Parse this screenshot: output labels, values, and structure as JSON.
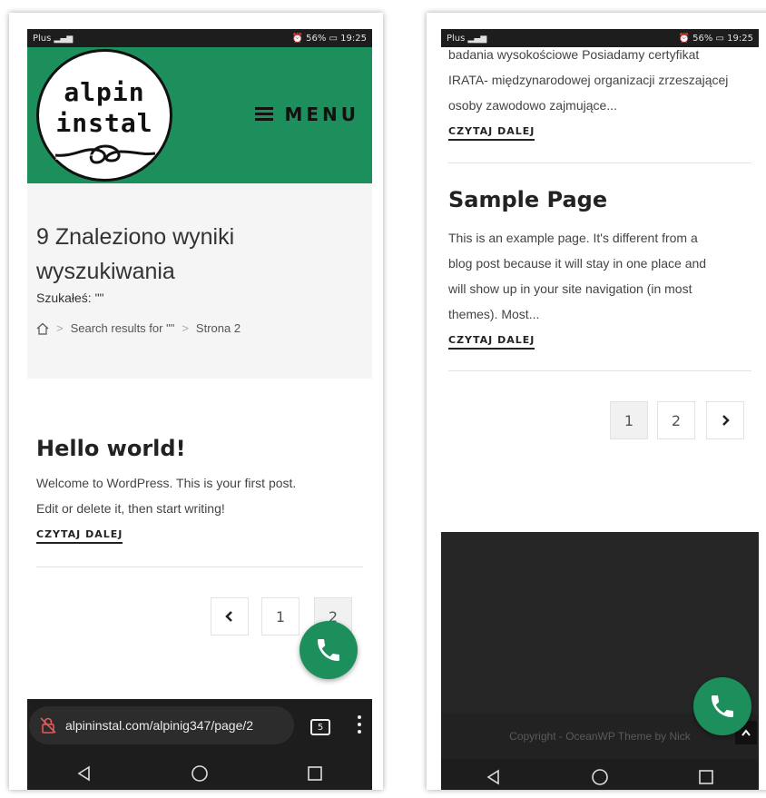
{
  "left": {
    "status": {
      "carrier": "Plus",
      "right": "56%",
      "time": "19:25"
    },
    "logo": {
      "line1": "alpin",
      "line2": "instal"
    },
    "menu_label": "MENU",
    "search": {
      "title": "9 Znaleziono wyniki wyszukiwania",
      "subtitle": "Szukałeś: \"\"",
      "breadcrumb": [
        "Search results for \"\"",
        "Strona 2"
      ]
    },
    "post": {
      "title": "Hello world!",
      "lines": [
        "Welcome to WordPress. This is your first post.",
        "Edit or delete it, then start writing!"
      ],
      "more": "CZYTAJ DALEJ"
    },
    "pagination": [
      "1",
      "2"
    ],
    "url": "alpininstal.com/alpinig347/page/2",
    "tab_count": "5"
  },
  "right": {
    "status": {
      "carrier": "Plus",
      "right": "56%",
      "time": "19:25"
    },
    "prev_text": [
      "badania wysokościowe Posiadamy certyfikat",
      "IRATA- międzynarodowej organizacji zrzeszającej",
      "osoby zawodowo zajmujące..."
    ],
    "prev_more": "CZYTAJ DALEJ",
    "post": {
      "title": "Sample Page",
      "lines": [
        "This is an example page. It's different from a",
        "blog post because it will stay in one place and",
        "will show up in your site navigation (in most",
        "themes). Most..."
      ],
      "more": "CZYTAJ DALEJ"
    },
    "pagination": [
      "1",
      "2"
    ],
    "copyright": "Copyright - OceanWP Theme by Nick"
  },
  "colors": {
    "brand_green": "#1d8f5c",
    "dark": "#1d1d1d"
  },
  "icons": [
    "home-icon",
    "hamburger-icon",
    "chevron-left-icon",
    "chevron-right-icon",
    "phone-icon",
    "no-lock-icon",
    "tabs-icon",
    "kebab-menu-icon",
    "back-icon",
    "home-circle-icon",
    "recents-icon",
    "chevron-up-icon"
  ]
}
